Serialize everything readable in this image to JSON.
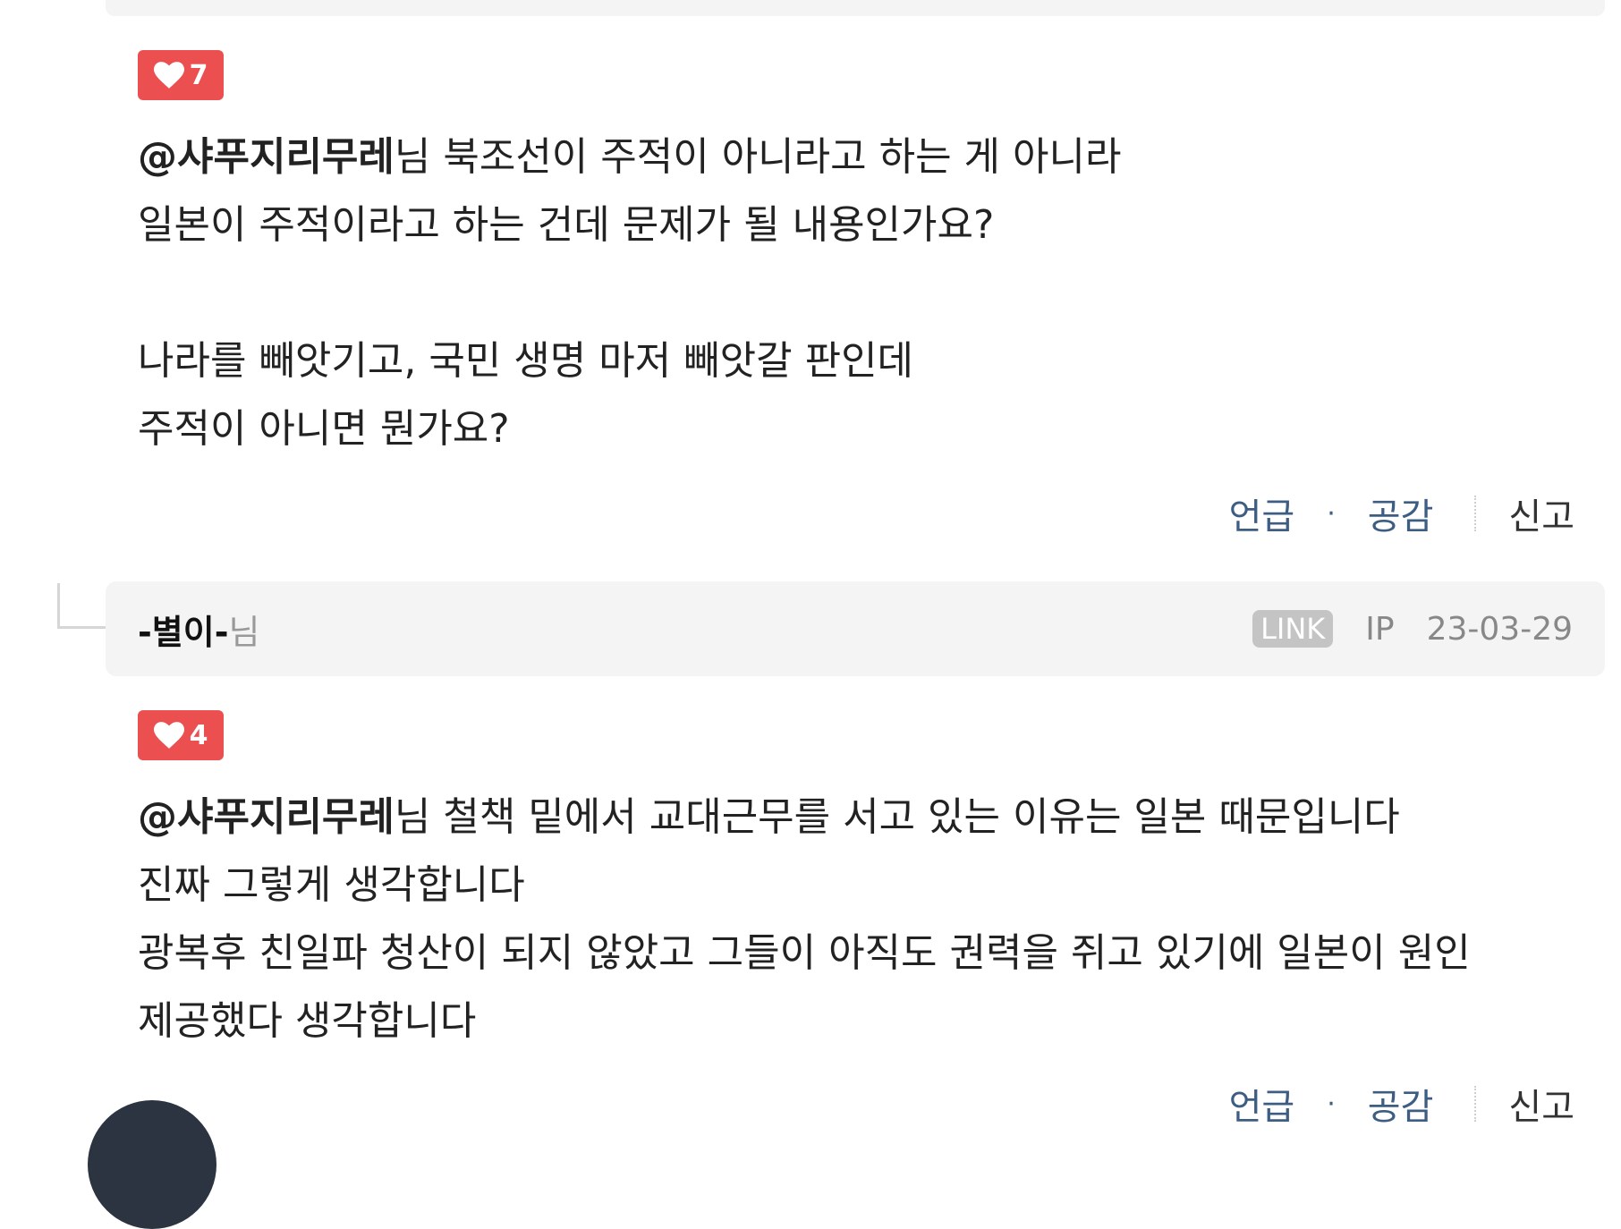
{
  "comments": [
    {
      "likes": "7",
      "mention": "@샤푸지리무레",
      "lines": [
        "님 북조선이 주적이 아니라고 하는 게 아니라",
        "일본이 주적이라고 하는 건데 문제가 될 내용인가요?",
        "",
        "나라를 빼앗기고, 국민 생명 마저 빼앗갈 판인데",
        "주적이 아니면 뭔가요?"
      ],
      "actions": {
        "mention": "언급",
        "dot": "·",
        "like": "공감",
        "report": "신고"
      }
    },
    {
      "author": "-별이-",
      "author_suffix": "님",
      "link_badge": "LINK",
      "ip_label": "IP",
      "date": "23-03-29",
      "likes": "4",
      "mention": "@샤푸지리무레",
      "lines": [
        "님 철책 밑에서 교대근무를 서고 있는 이유는 일본 때문입니다",
        "진짜 그렇게 생각합니다",
        "광복후 친일파 청산이 되지 않았고 그들이 아직도 권력을 쥐고 있기에 일본이 원인",
        "제공했다 생각합니다"
      ],
      "actions": {
        "mention": "언급",
        "dot": "·",
        "like": "공감",
        "report": "신고"
      }
    }
  ],
  "colors": {
    "like_badge": "#ec4f4f",
    "action_link": "#3d5e82",
    "header_bg": "#f4f4f4"
  },
  "icons": {
    "like": "heart-icon"
  }
}
